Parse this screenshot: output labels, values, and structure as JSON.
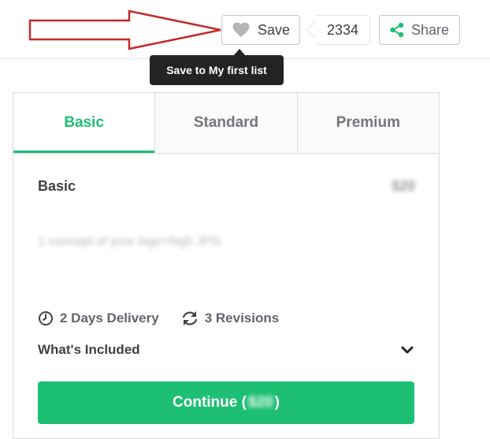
{
  "header": {
    "save_label": "Save",
    "save_count": "2334",
    "share_label": "Share",
    "tooltip": "Save to My first list"
  },
  "tabs": [
    {
      "label": "Basic",
      "active": true
    },
    {
      "label": "Standard",
      "active": false
    },
    {
      "label": "Premium",
      "active": false
    }
  ],
  "package": {
    "title": "Basic",
    "price": "$20",
    "description": "1 concept of your logo+high JPG",
    "delivery": "2 Days Delivery",
    "revisions": "3 Revisions",
    "included_label": "What's Included"
  },
  "continue": {
    "label_prefix": "Continue (",
    "price": "$20",
    "label_suffix": ")"
  },
  "colors": {
    "accent_green": "#1dbf73",
    "annotation_red": "#c62828",
    "tooltip_bg": "#222325",
    "heart_gray": "#b5b6ba"
  },
  "icons": {
    "save": "heart-icon",
    "share": "share-icon",
    "delivery": "clock-icon",
    "revisions": "refresh-icon",
    "expand": "chevron-down-icon",
    "annotation": "arrow-annotation"
  }
}
